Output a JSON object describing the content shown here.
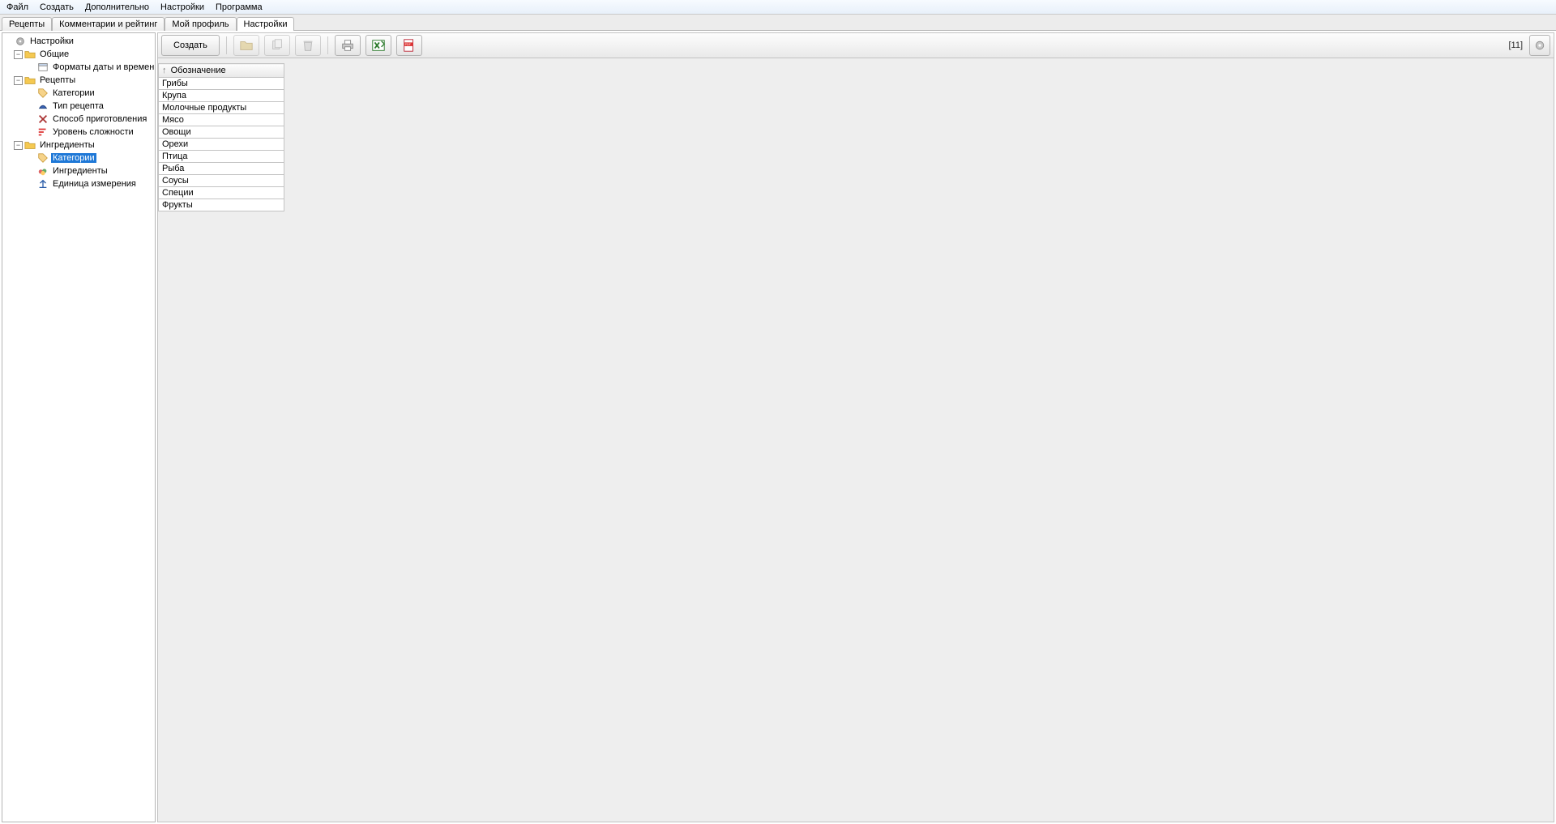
{
  "menu": {
    "items": [
      "Файл",
      "Создать",
      "Дополнительно",
      "Настройки",
      "Программа"
    ]
  },
  "tabs": {
    "items": [
      {
        "label": "Рецепты",
        "active": false
      },
      {
        "label": "Комментарии и рейтинг",
        "active": false
      },
      {
        "label": "Мой профиль",
        "active": false
      },
      {
        "label": "Настройки",
        "active": true
      }
    ]
  },
  "tree": {
    "root": "Настройки",
    "group_general": "Общие",
    "general_dateformats": "Форматы даты и времени",
    "group_recipes": "Рецепты",
    "recipes_categories": "Категории",
    "recipes_type": "Тип рецепта",
    "recipes_cooking": "Способ приготовления",
    "recipes_difficulty": "Уровень сложности",
    "group_ingredients": "Ингредиенты",
    "ingredients_categories": "Категории",
    "ingredients_ingredients": "Ингредиенты",
    "ingredients_units": "Единица измерения"
  },
  "toolbar": {
    "create": "Создать",
    "count": "[11]"
  },
  "grid": {
    "header": "Обозначение",
    "sort_indicator": "↑",
    "rows": [
      "Грибы",
      "Крупа",
      "Молочные продукты",
      "Мясо",
      "Овощи",
      "Орехи",
      "Птица",
      "Рыба",
      "Соусы",
      "Специи",
      "Фрукты"
    ]
  }
}
